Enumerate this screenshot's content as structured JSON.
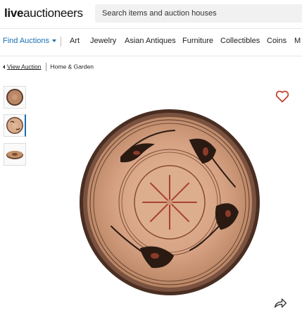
{
  "header": {
    "logo_bold": "live",
    "logo_rest": "auctioneers",
    "search_placeholder": "Search items and auction houses"
  },
  "nav": {
    "find_auctions": "Find Auctions",
    "items": [
      "Art",
      "Jewelry",
      "Asian Antiques",
      "Furniture",
      "Collectibles",
      "Coins",
      "M"
    ]
  },
  "breadcrumb": {
    "back": "View Auction",
    "category": "Home & Garden"
  },
  "colors": {
    "accent": "#1b6fb3",
    "favorite": "#c0392b"
  },
  "icons": [
    "heart-icon",
    "share-icon",
    "caret-down-icon",
    "back-arrow-icon"
  ]
}
